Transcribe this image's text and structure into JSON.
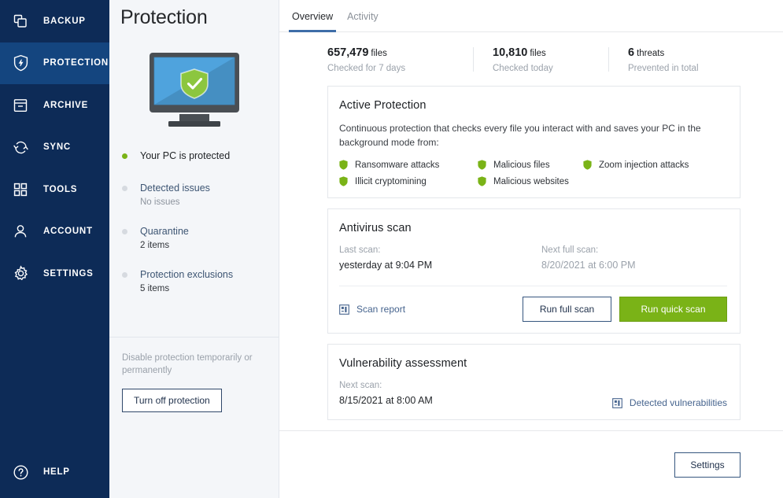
{
  "sidebar": {
    "items": [
      {
        "label": "BACKUP",
        "icon": "copies-icon",
        "active": false
      },
      {
        "label": "PROTECTION",
        "icon": "shield-bolt-icon",
        "active": true
      },
      {
        "label": "ARCHIVE",
        "icon": "archive-box-icon",
        "active": false
      },
      {
        "label": "SYNC",
        "icon": "sync-arrows-icon",
        "active": false
      },
      {
        "label": "TOOLS",
        "icon": "grid-squares-icon",
        "active": false
      },
      {
        "label": "ACCOUNT",
        "icon": "person-icon",
        "active": false
      },
      {
        "label": "SETTINGS",
        "icon": "gear-icon",
        "active": false
      }
    ],
    "help": {
      "label": "HELP",
      "icon": "question-circle-icon"
    },
    "colors": {
      "background": "#0d2b57",
      "active_background": "#14457f",
      "text": "#ffffff"
    }
  },
  "left_panel": {
    "title": "Protection",
    "illustration": "monitor-with-green-shield",
    "status": {
      "label": "Your PC is protected",
      "dot_color": "#7ab317"
    },
    "items": [
      {
        "title": "Detected issues",
        "value": "No issues",
        "value_muted": true
      },
      {
        "title": "Quarantine",
        "value": "2 items",
        "value_muted": false
      },
      {
        "title": "Protection exclusions",
        "value": "5 items",
        "value_muted": false
      }
    ],
    "disable_note": "Disable protection temporarily or permanently",
    "turn_off_button": "Turn off protection"
  },
  "main": {
    "tabs": [
      {
        "label": "Overview",
        "active": true
      },
      {
        "label": "Activity",
        "active": false
      }
    ],
    "stats": [
      {
        "number": "657,479",
        "unit": "files",
        "sub": "Checked for 7 days"
      },
      {
        "number": "10,810",
        "unit": "files",
        "sub": "Checked today"
      },
      {
        "number": "6",
        "unit": "threats",
        "sub": "Prevented in total"
      }
    ],
    "active_protection": {
      "title": "Active Protection",
      "description": "Continuous protection that checks every file you interact with and saves your PC in the background mode from:",
      "features": [
        "Ransomware attacks",
        "Malicious files",
        "Zoom injection attacks",
        "Illicit cryptomining",
        "Malicious websites"
      ],
      "feature_icon": "green-shield-icon",
      "feature_icon_color": "#7ab317"
    },
    "antivirus_scan": {
      "title": "Antivirus scan",
      "last_scan_label": "Last scan:",
      "last_scan_value": "yesterday at 9:04 PM",
      "next_scan_label": "Next full scan:",
      "next_scan_value": "8/20/2021 at 6:00 PM",
      "report_link": "Scan report",
      "report_icon": "report-document-icon",
      "full_scan_button": "Run full scan",
      "quick_scan_button": "Run quick scan",
      "quick_scan_color": "#7ab317"
    },
    "vulnerability": {
      "title": "Vulnerability assessment",
      "next_scan_label": "Next scan:",
      "next_scan_value": "8/15/2021 at 8:00 AM",
      "detected_link": "Detected vulnerabilities",
      "detected_icon": "report-document-icon"
    },
    "footer": {
      "settings_button": "Settings"
    }
  }
}
